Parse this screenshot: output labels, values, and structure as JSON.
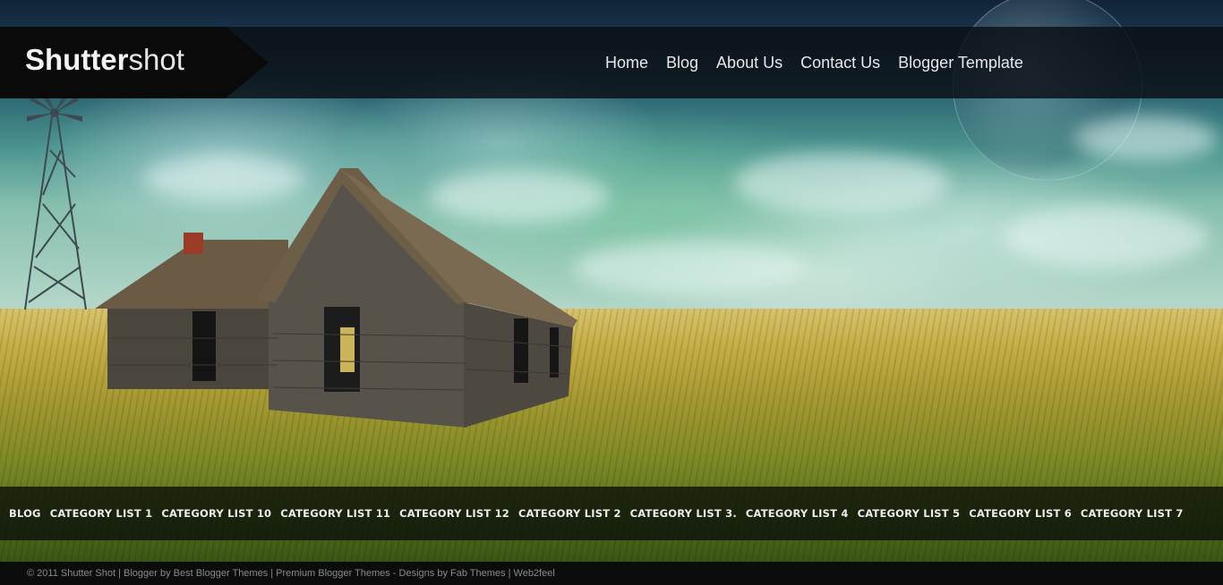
{
  "header": {
    "logo": {
      "bold": "Shutter",
      "light": "shot"
    },
    "nav": [
      {
        "label": "Home"
      },
      {
        "label": "Blog"
      },
      {
        "label": "About Us"
      },
      {
        "label": "Contact Us"
      },
      {
        "label": "Blogger Template"
      }
    ]
  },
  "categories": [
    {
      "label": "BLOG"
    },
    {
      "label": "CATEGORY LIST 1"
    },
    {
      "label": "CATEGORY LIST 10"
    },
    {
      "label": "CATEGORY LIST 11"
    },
    {
      "label": "CATEGORY LIST 12"
    },
    {
      "label": "CATEGORY LIST 2"
    },
    {
      "label": "CATEGORY LIST 3."
    },
    {
      "label": "CATEGORY LIST 4"
    },
    {
      "label": "CATEGORY LIST 5"
    },
    {
      "label": "CATEGORY LIST 6"
    },
    {
      "label": "CATEGORY LIST 7"
    }
  ],
  "footer": {
    "text": "© 2011 Shutter Shot | Blogger by Best Blogger Themes | Premium Blogger Themes - Designs by Fab Themes | Web2feel"
  },
  "colors": {
    "header_bg": "#0e1218",
    "logo_bg": "#0a0a0a",
    "nav_text": "#e8e8e8",
    "category_text": "#ececec",
    "footer_text": "#8a8a8a"
  }
}
